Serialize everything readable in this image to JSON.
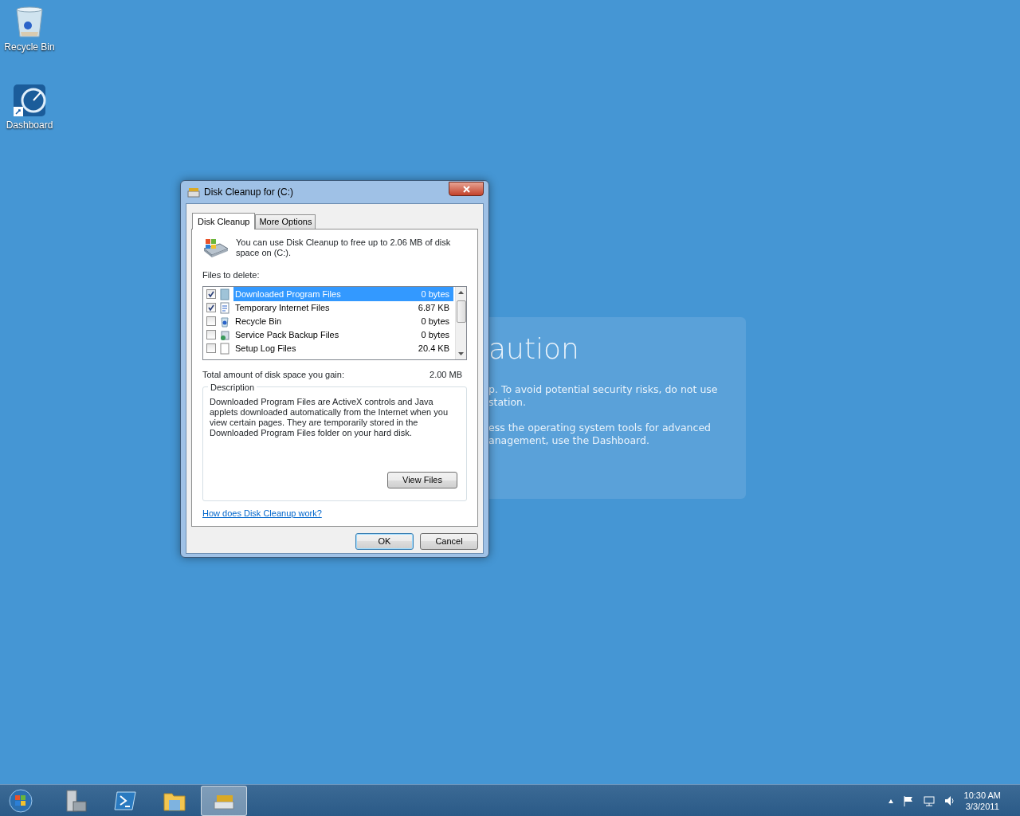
{
  "desktop_icons": [
    {
      "label": "Recycle Bin",
      "kind": "bin"
    },
    {
      "label": "Dashboard",
      "kind": "dashboard"
    }
  ],
  "background_panel": {
    "title": "aution",
    "paragraphs": [
      [
        "p. To avoid potential security risks, do not use",
        "station."
      ],
      [
        "ess the operating system tools for advanced",
        "anagement, use the Dashboard."
      ]
    ]
  },
  "window": {
    "title": "Disk Cleanup for  (C:)",
    "tabs": [
      {
        "label": "Disk Cleanup",
        "selected": true
      },
      {
        "label": "More Options",
        "selected": false
      }
    ],
    "intro": "You can use Disk Cleanup to free up to 2.06 MB of disk space on  (C:).",
    "files_label": "Files to delete:",
    "files": [
      {
        "name": "Downloaded Program Files",
        "size": "0 bytes",
        "checked": true,
        "selected": true
      },
      {
        "name": "Temporary Internet Files",
        "size": "6.87 KB",
        "checked": true,
        "selected": false
      },
      {
        "name": "Recycle Bin",
        "size": "0 bytes",
        "checked": false,
        "selected": false
      },
      {
        "name": "Service Pack Backup Files",
        "size": "0 bytes",
        "checked": false,
        "selected": false
      },
      {
        "name": "Setup Log Files",
        "size": "20.4 KB",
        "checked": false,
        "selected": false
      }
    ],
    "total_label": "Total amount of disk space you gain:",
    "total_value": "2.00 MB",
    "description_title": "Description",
    "description": "Downloaded Program Files are ActiveX controls and Java applets downloaded automatically from the Internet when you view certain pages. They are temporarily stored in the Downloaded Program Files folder on your hard disk.",
    "view_files_button": "View Files",
    "help_link": "How does Disk Cleanup work?",
    "buttons": [
      "OK",
      "Cancel"
    ]
  },
  "taskbar": {
    "items": [
      {
        "kind": "start",
        "selected": false
      },
      {
        "kind": "server",
        "selected": false
      },
      {
        "kind": "shell",
        "selected": false
      },
      {
        "kind": "folder",
        "selected": false
      },
      {
        "kind": "cleanup",
        "selected": true
      }
    ],
    "clock": {
      "time": "10:30 AM",
      "date": "3/3/2011"
    }
  }
}
